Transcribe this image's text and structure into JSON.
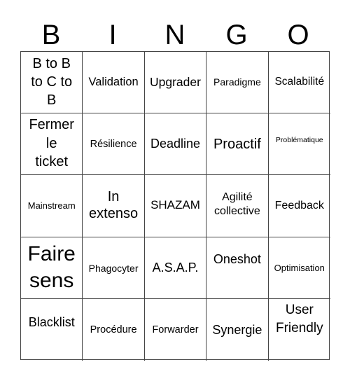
{
  "header": {
    "letters": [
      "B",
      "I",
      "N",
      "G",
      "O"
    ]
  },
  "cells": [
    [
      "B to B\nto C to\nB",
      "Validation",
      "Upgrader",
      "Paradigme",
      "Scalabilité"
    ],
    [
      "Fermer\nle\nticket",
      "Résilience",
      "Deadline",
      "Proactif",
      "Problématique"
    ],
    [
      "Mainstream",
      "In\nextenso",
      "SHAZAM",
      "Agilité\ncollective",
      "Feedback"
    ],
    [
      "Faire\nsens",
      "Phagocyter",
      "A.S.A.P.",
      "Oneshot",
      "Optimisation"
    ],
    [
      "Blacklist",
      "Procédure",
      "Forwarder",
      "Synergie",
      "User\nFriendly"
    ]
  ]
}
